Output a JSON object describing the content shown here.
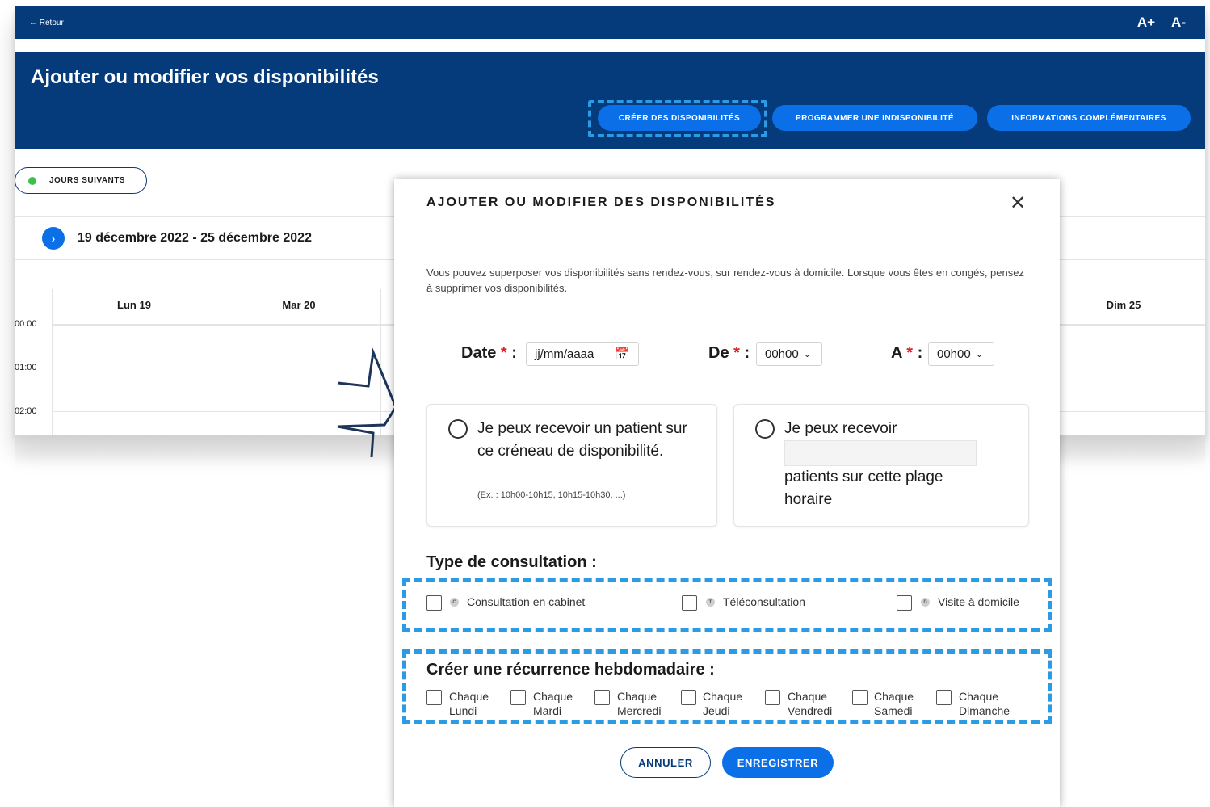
{
  "app": {
    "back_label": "← Retour",
    "font_increase": "A+",
    "font_decrease": "A-",
    "page_title": "Ajouter ou modifier vos disponibilités",
    "actions": {
      "create": "CRÉER DES DISPONIBILITÉS",
      "unavailability": "PROGRAMMER UNE INDISPONIBILITÉ",
      "more_info": "INFORMATIONS COMPLÉMENTAIRES"
    },
    "next_days": "JOURS SUIVANTS",
    "week_range": "19 décembre 2022 - 25 décembre 2022",
    "next_arrow": "›",
    "days": [
      "Lun 19",
      "Mar 20",
      "Dim 25"
    ],
    "hours": [
      "00:00",
      "01:00",
      "02:00"
    ]
  },
  "modal": {
    "title": "AJOUTER OU MODIFIER DES DISPONIBILITÉS",
    "close": "✕",
    "info": "Vous pouvez superposer vos disponibilités sans rendez-vous, sur rendez-vous à domicile. Lorsque vous êtes en congés, pensez à supprimer vos disponibilités.",
    "date_label": "Date",
    "date_placeholder": "jj/mm/aaaa",
    "from_label": "De",
    "from_value": "00h00",
    "to_label": "A",
    "to_value": "00h00",
    "required_mark": "*",
    "colon": ":",
    "option_single": {
      "text": "Je peux recevoir un patient sur ce créneau de disponibilité.",
      "example": "(Ex. : 10h00-10h15, 10h15-10h30, ...)"
    },
    "option_multi": {
      "text_before": "Je peux recevoir",
      "text_after": "patients sur cette plage horaire"
    },
    "consultation_title": "Type de consultation :",
    "consultation_types": [
      {
        "badge": "C",
        "label": "Consultation en cabinet"
      },
      {
        "badge": "T",
        "label": "Téléconsultation"
      },
      {
        "badge": "D",
        "label": "Visite à domicile"
      }
    ],
    "recurrence_title": "Créer une récurrence hebdomadaire :",
    "recurrence_days": [
      {
        "line1": "Chaque",
        "line2": "Lundi"
      },
      {
        "line1": "Chaque",
        "line2": "Mardi"
      },
      {
        "line1": "Chaque",
        "line2": "Mercredi"
      },
      {
        "line1": "Chaque",
        "line2": "Jeudi"
      },
      {
        "line1": "Chaque",
        "line2": "Vendredi"
      },
      {
        "line1": "Chaque",
        "line2": "Samedi"
      },
      {
        "line1": "Chaque",
        "line2": "Dimanche"
      }
    ],
    "cancel": "ANNULER",
    "save": "ENREGISTRER"
  },
  "colors": {
    "navy": "#053b7a",
    "primary_blue": "#0b6fe8",
    "highlight_dash": "#2d9ae6",
    "required_red": "#e31b23",
    "status_green": "#3bbf4d"
  }
}
